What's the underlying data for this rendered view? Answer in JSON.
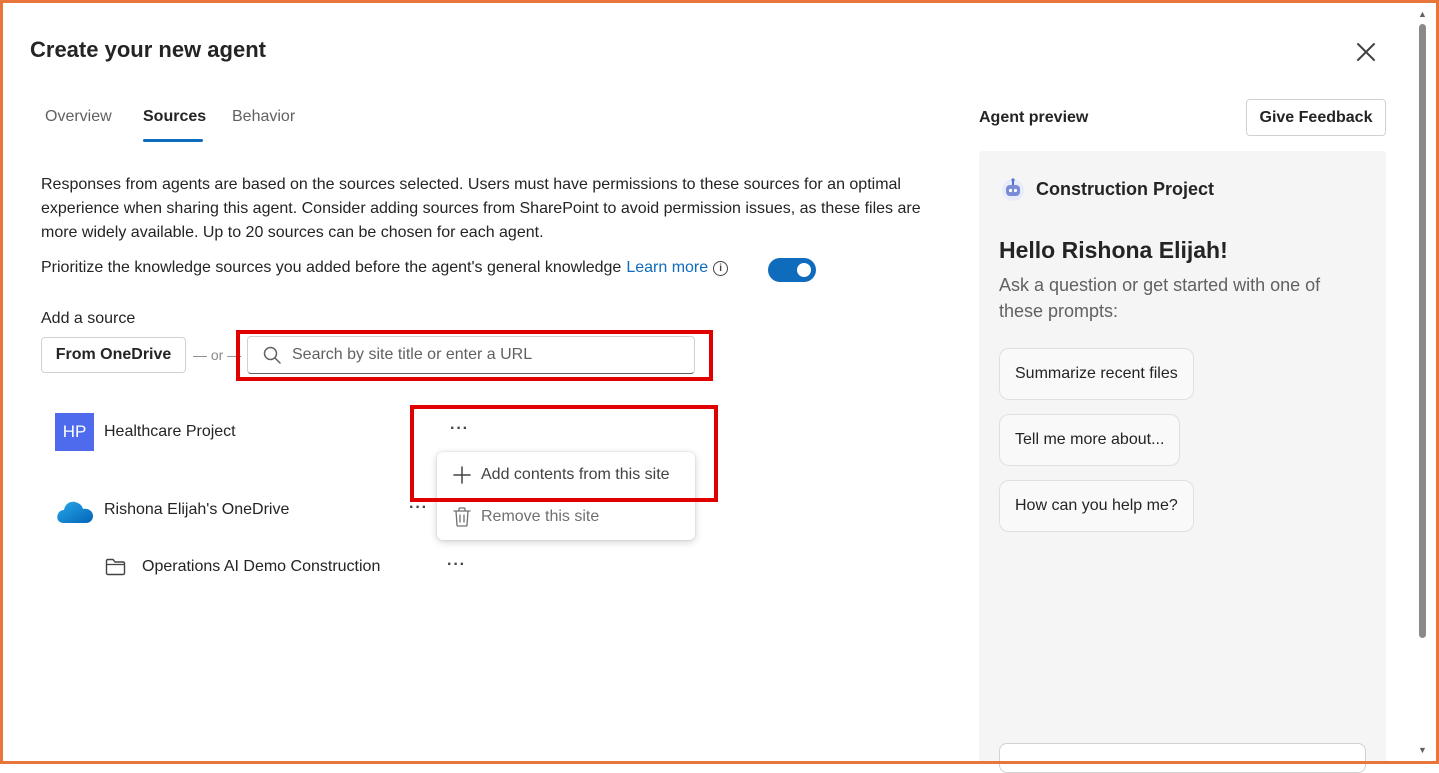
{
  "dialog": {
    "title": "Create your new agent"
  },
  "tabs": [
    {
      "label": "Overview"
    },
    {
      "label": "Sources"
    },
    {
      "label": "Behavior"
    }
  ],
  "sources": {
    "description": "Responses from agents are based on the sources selected. Users must have permissions to these sources for an optimal experience when sharing this agent. Consider adding sources from SharePoint to avoid permission issues, as these files are more widely available. Up to 20 sources can be chosen for each agent.",
    "prioritize_text": "Prioritize the knowledge sources you added before the agent's general knowledge",
    "learn_more": "Learn more",
    "info_glyph": "i",
    "toggle_on": true,
    "add_source_label": "Add a source",
    "from_onedrive_label": "From OneDrive",
    "or_label": "— or —",
    "search_placeholder": "Search by site title or enter a URL",
    "items": [
      {
        "badge": "HP",
        "label": "Healthcare Project",
        "icon": "sharepoint-site-icon"
      },
      {
        "label": "Rishona Elijah's OneDrive",
        "icon": "onedrive-cloud-icon"
      },
      {
        "label": "Operations AI Demo Construction",
        "icon": "folder-icon"
      }
    ],
    "more_glyph": "···"
  },
  "context_menu": {
    "add_label": "Add contents from this site",
    "remove_label": "Remove this site"
  },
  "preview": {
    "title": "Agent preview",
    "feedback_label": "Give Feedback",
    "agent_name": "Construction Project",
    "greeting": "Hello Rishona Elijah!",
    "subtext": "Ask a question or get started with one of these prompts:",
    "prompts": [
      {
        "label": "Summarize recent files"
      },
      {
        "label": "Tell me more about..."
      },
      {
        "label": "How can you help me?"
      }
    ]
  },
  "colors": {
    "accent": "#0f6cbd",
    "highlight_box": "#e00000",
    "frame": "#e8763a",
    "site_badge": "#4f6bed"
  }
}
